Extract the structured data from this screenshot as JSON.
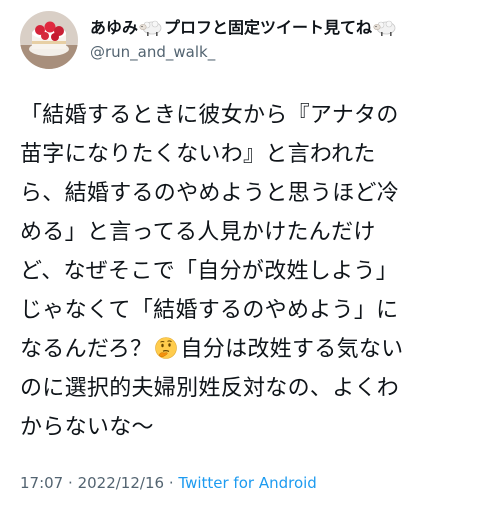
{
  "tweet": {
    "author": {
      "display_name_part1": "あゆみ",
      "display_name_part2": "プロフと固定ツイート見てね",
      "handle": "@run_and_walk_",
      "name_icon": "sheep-emoji"
    },
    "text_lines": [
      "「結婚するときに彼女から『アナタの",
      "苗字になりたくないわ』と言われた",
      "ら、結婚するのやめようと思うほど冷",
      "める」と言ってる人見かけたんだけ",
      "ど、なぜそこで「自分が改姓しよう」",
      "じゃなくて「結婚するのやめよう」に",
      "なるんだろ？",
      "自分は改姓する気ない",
      "のに選択的夫婦別姓反対なの、よくわ",
      "からないな〜"
    ],
    "inline_icon": "thinking-face-emoji",
    "time": "17:07",
    "separator": "·",
    "date": "2022/12/16",
    "source": "Twitter for Android"
  },
  "colors": {
    "text": "#0f1419",
    "secondary": "#536471",
    "link": "#1d9bf0"
  }
}
